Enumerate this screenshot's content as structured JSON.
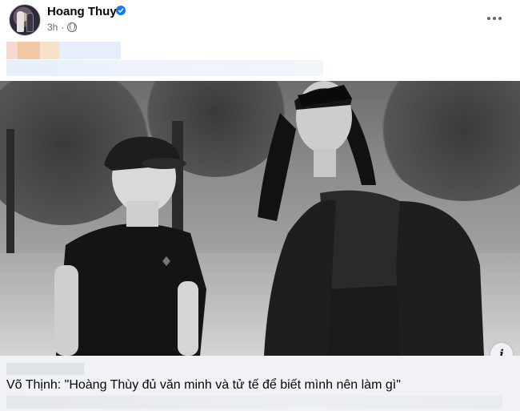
{
  "post": {
    "author_name": "Hoang Thuy",
    "timestamp": "3h",
    "audience_icon": "globe-icon",
    "verified_icon": "verified-badge-icon",
    "more_icon": "more-options-icon"
  },
  "link_preview": {
    "title": "Võ Thịnh: \"Hoàng Thùy đủ văn minh và tử tế để biết mình nên làm gì\"",
    "info_label": "i"
  },
  "colors": {
    "accent": "#1877f2",
    "secondary_text": "#65676b",
    "link_bg": "#f0f2f5"
  }
}
